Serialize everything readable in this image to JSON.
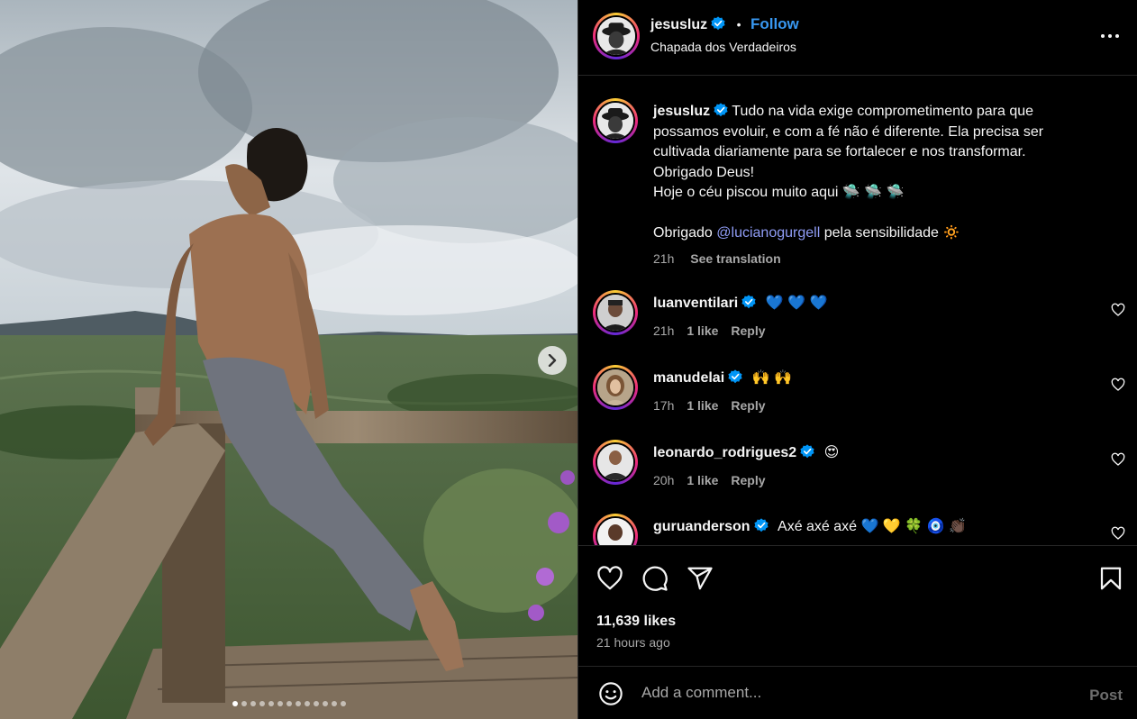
{
  "post": {
    "username": "jesusluz",
    "follow_label": "Follow",
    "separator": "•",
    "location": "Chapada dos Verdadeiros",
    "caption_lines": [
      "Tudo na vida exige comprometimento para que",
      "possamos evoluir, e com a fé não é diferente. Ela precisa ser",
      "cultivada diariamente para se fortalecer e nos transformar.",
      "Obrigado Deus!",
      "Hoje o céu piscou muito aqui 🛸 🛸 🛸"
    ],
    "thanks_prefix": "Obrigado",
    "thanks_mention": "@lucianogurgell",
    "thanks_suffix": "pela sensibilidade 🔅",
    "caption_time": "21h",
    "see_translation": "See translation",
    "likes": "11,639 likes",
    "time_ago": "21 hours ago",
    "carousel_count": 13,
    "carousel_active": 0
  },
  "comments": [
    {
      "username": "luanventilari",
      "text": "💙 💙 💙",
      "time": "21h",
      "likes": "1 like",
      "reply": "Reply"
    },
    {
      "username": "manudelai",
      "text": "🙌 🙌",
      "time": "17h",
      "likes": "1 like",
      "reply": "Reply"
    },
    {
      "username": "leonardo_rodrigues2",
      "text": "😍",
      "time": "20h",
      "likes": "1 like",
      "reply": "Reply"
    },
    {
      "username": "guruanderson",
      "text": "Axé axé axé 💙 💛 🍀 🧿 👏🏿",
      "time": "",
      "likes": "",
      "reply": ""
    }
  ],
  "add_comment": {
    "placeholder": "Add a comment...",
    "post_label": "Post"
  },
  "icons": {
    "more": "more-options-icon",
    "like": "heart-icon",
    "comment": "comment-icon",
    "share": "send-icon",
    "save": "bookmark-icon",
    "emoji": "emoji-icon",
    "next": "chevron-right-icon",
    "verified": "verified-badge-icon"
  },
  "colors": {
    "link": "#3897f0",
    "mention": "#8f9cf5",
    "verified": "#0095f6",
    "background": "#000000"
  }
}
